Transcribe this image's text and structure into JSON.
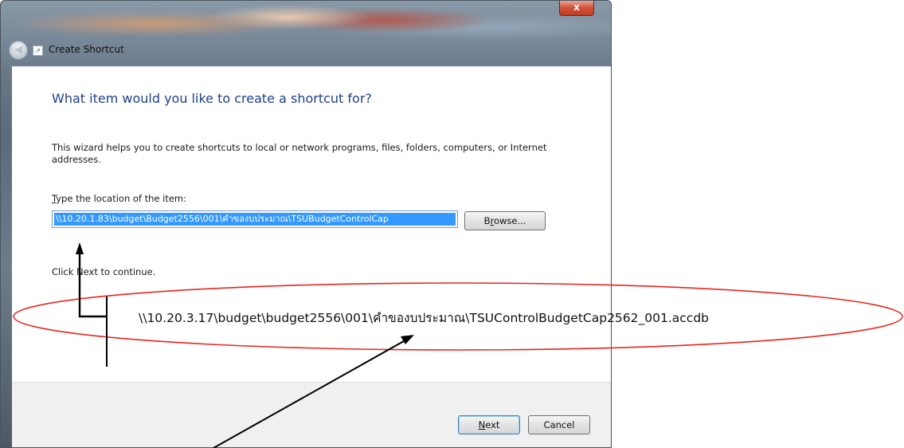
{
  "window": {
    "title": "Create Shortcut",
    "close_glyph": "x"
  },
  "wizard": {
    "heading": "What item would you like to create a shortcut for?",
    "description": "This wizard helps you to create shortcuts to local or network programs, files, folders, computers, or Internet addresses.",
    "location_label_mnemonic": "T",
    "location_label_rest": "ype the location of the item:",
    "location_value": "\\\\10.20.1.83\\budget\\Budget2556\\001\\คำของบประมาณ\\TSUBudgetControlCap",
    "browse_label_pre": "B",
    "browse_label_mnemonic": "r",
    "browse_label_post": "owse...",
    "hint": "Click Next to continue."
  },
  "footer": {
    "next_mnemonic": "N",
    "next_rest": "ext",
    "cancel_label": "Cancel"
  },
  "annotation": {
    "callout_text": "\\\\10.20.3.17\\budget\\budget2556\\001\\คำของบประมาณ\\TSUControlBudgetCap2562_001.accdb",
    "ellipse_color": "#e8251f",
    "arrow_color": "#000000"
  },
  "icons": {
    "back": "back-arrow-icon",
    "wizard": "shortcut-wizard-icon",
    "close": "close-icon"
  }
}
